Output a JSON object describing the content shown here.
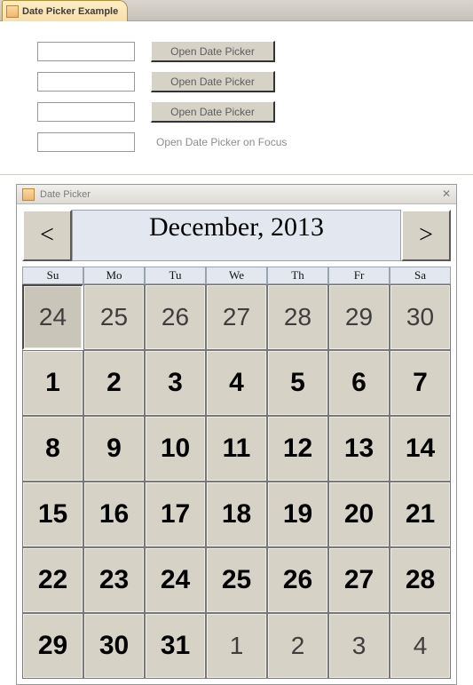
{
  "topbar": {
    "tab_label": "Date Picker Example"
  },
  "rows": [
    {
      "value": "",
      "button": "Open Date Picker",
      "type": "button"
    },
    {
      "value": "",
      "button": "Open Date Picker",
      "type": "button"
    },
    {
      "value": "",
      "button": "Open Date Picker",
      "type": "button"
    },
    {
      "value": "",
      "button": "Open Date Picker on Focus",
      "type": "label"
    }
  ],
  "picker": {
    "title": "Date Picker",
    "month_label": "December, 2013",
    "prev": "<",
    "next": ">",
    "close": "✕",
    "dow": [
      "Su",
      "Mo",
      "Tu",
      "We",
      "Th",
      "Fr",
      "Sa"
    ],
    "cells": [
      {
        "n": 24,
        "other": true,
        "selected": true
      },
      {
        "n": 25,
        "other": true
      },
      {
        "n": 26,
        "other": true
      },
      {
        "n": 27,
        "other": true
      },
      {
        "n": 28,
        "other": true
      },
      {
        "n": 29,
        "other": true
      },
      {
        "n": 30,
        "other": true
      },
      {
        "n": 1
      },
      {
        "n": 2
      },
      {
        "n": 3
      },
      {
        "n": 4
      },
      {
        "n": 5
      },
      {
        "n": 6
      },
      {
        "n": 7
      },
      {
        "n": 8
      },
      {
        "n": 9
      },
      {
        "n": 10
      },
      {
        "n": 11
      },
      {
        "n": 12
      },
      {
        "n": 13
      },
      {
        "n": 14
      },
      {
        "n": 15
      },
      {
        "n": 16
      },
      {
        "n": 17
      },
      {
        "n": 18
      },
      {
        "n": 19
      },
      {
        "n": 20
      },
      {
        "n": 21
      },
      {
        "n": 22
      },
      {
        "n": 23
      },
      {
        "n": 24
      },
      {
        "n": 25
      },
      {
        "n": 26
      },
      {
        "n": 27
      },
      {
        "n": 28
      },
      {
        "n": 29
      },
      {
        "n": 30
      },
      {
        "n": 31
      },
      {
        "n": 1,
        "other": true
      },
      {
        "n": 2,
        "other": true
      },
      {
        "n": 3,
        "other": true
      },
      {
        "n": 4,
        "other": true
      }
    ]
  }
}
